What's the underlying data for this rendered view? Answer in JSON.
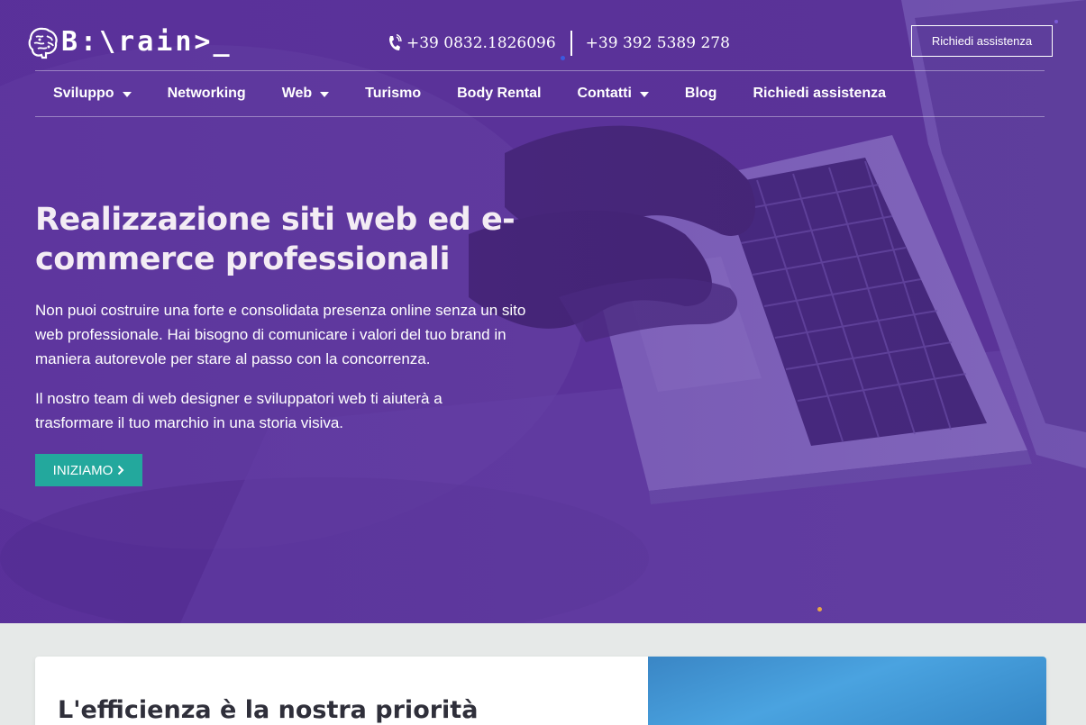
{
  "header": {
    "logo_text": "B:\\rain>_",
    "phone_1": "+39 0832.1826096",
    "phone_2": "+39 392 5389 278",
    "assist_button": "Richiedi assistenza"
  },
  "nav": {
    "items": [
      {
        "label": "Sviluppo",
        "has_dropdown": true
      },
      {
        "label": "Networking",
        "has_dropdown": false
      },
      {
        "label": "Web",
        "has_dropdown": true
      },
      {
        "label": "Turismo",
        "has_dropdown": false
      },
      {
        "label": "Body Rental",
        "has_dropdown": false
      },
      {
        "label": "Contatti",
        "has_dropdown": true
      },
      {
        "label": "Blog",
        "has_dropdown": false
      },
      {
        "label": "Richiedi assistenza",
        "has_dropdown": false
      }
    ]
  },
  "hero": {
    "title": "Realizzazione siti web ed e-commerce professionali",
    "paragraph_1": "Non puoi costruire una forte e consolidata presenza online senza un sito web professionale. Hai bisogno di comunicare i valori del tuo brand in maniera autorevole per stare al passo con la concorrenza.",
    "paragraph_2": "Il nostro team di web designer e sviluppatori web ti aiuterà a trasformare il tuo marchio in una storia visiva.",
    "cta_label": "INIZIAMO"
  },
  "section": {
    "title": "L'efficienza è la nostra priorità"
  },
  "colors": {
    "hero_purple": "#5a3494",
    "accent_teal": "#23a89d",
    "page_bg": "#e6e9e8"
  },
  "icons": [
    "brain-logo-icon",
    "phone-icon",
    "chevron-down-icon",
    "chevron-right-icon"
  ]
}
